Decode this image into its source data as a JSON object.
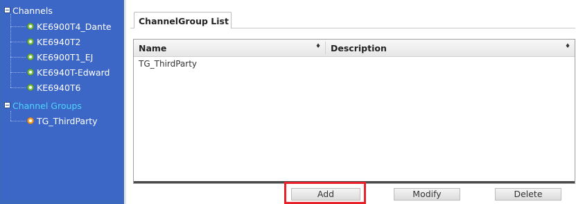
{
  "sidebar": {
    "channels_label": "Channels",
    "channels": [
      "KE6900T4_Dante",
      "KE6940T2",
      "KE6900T1_EJ",
      "KE6940T-Edward",
      "KE6940T6"
    ],
    "groups_label": "Channel Groups",
    "groups": [
      "TG_ThirdParty"
    ]
  },
  "tab": {
    "label": "ChannelGroup List"
  },
  "table": {
    "columns": [
      "Name",
      "Description"
    ],
    "sort_glyph": "♦",
    "rows": [
      {
        "name": "TG_ThirdParty",
        "description": ""
      }
    ]
  },
  "buttons": {
    "add": "Add",
    "modify": "Modify",
    "delete": "Delete"
  },
  "colors": {
    "sidebar_bg": "#3d67c7",
    "group_text": "#4fd5ff",
    "channel_dot": "#7ec34d",
    "group_dot": "#f3a73b",
    "highlight": "#e8202a"
  }
}
